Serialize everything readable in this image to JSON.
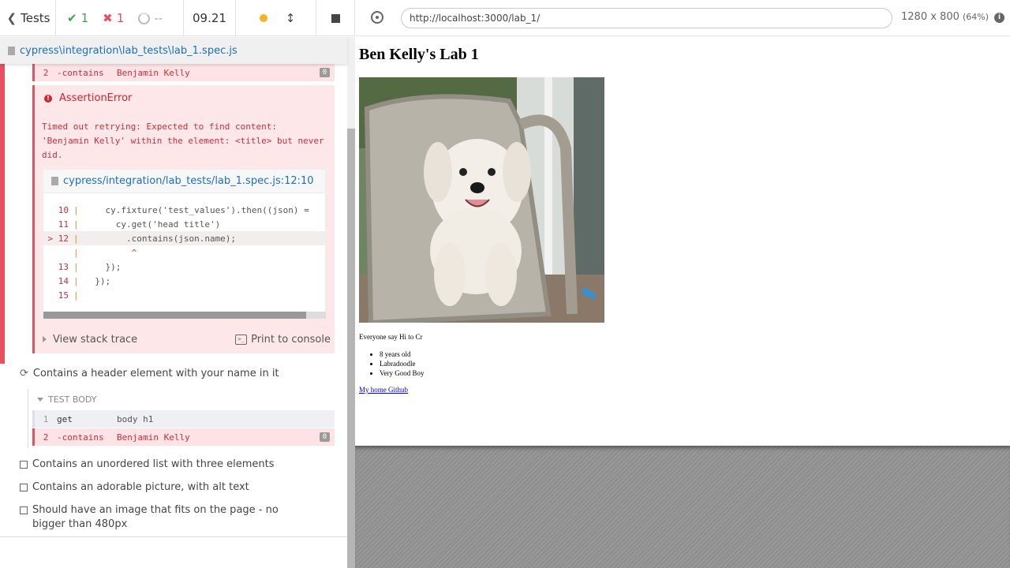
{
  "topbar": {
    "tests_label": "Tests",
    "passed": "1",
    "failed": "1",
    "pending": "--",
    "duration": "09.21"
  },
  "spec": {
    "path": "cypress\\integration\\lab_tests\\lab_1.spec.js"
  },
  "test1": {
    "cmd_num": "2",
    "cmd_name": "-contains",
    "cmd_arg": "Benjamin Kelly",
    "badge": "0",
    "error": {
      "title": "AssertionError",
      "message_line1": "Timed out retrying: Expected to find content:",
      "message_line2": "'Benjamin Kelly' within the element: <title> but never",
      "message_line3": "did.",
      "file_link": "cypress/integration/lab_tests/lab_1.spec.js:12:10",
      "code": [
        {
          "ln": "10",
          "text": "    cy.fixture('test_values').then((json) ="
        },
        {
          "ln": "11",
          "text": "      cy.get('head title')"
        },
        {
          "ln": "> 12",
          "text": "        .contains(json.name);"
        },
        {
          "ln": "",
          "text": "         ^"
        },
        {
          "ln": "13",
          "text": "    });"
        },
        {
          "ln": "14",
          "text": "  });"
        },
        {
          "ln": "15",
          "text": ""
        }
      ],
      "view_stack": "View stack trace",
      "print_console": "Print to console"
    }
  },
  "test2": {
    "title": "Contains a header element with your name in it",
    "section": "TEST BODY",
    "cmds": [
      {
        "num": "1",
        "name": "get",
        "arg": "body h1"
      },
      {
        "num": "2",
        "name": "-contains",
        "arg": "Benjamin Kelly",
        "badge": "0"
      }
    ]
  },
  "pending_tests": [
    "Contains an unordered list with three elements",
    "Contains an adorable picture, with alt text",
    "Should have an image that fits on the page - no bigger than 480px"
  ],
  "browser": {
    "url": "http://localhost:3000/lab_1/",
    "viewport": "1280 x 800",
    "scale": "(64%)"
  },
  "aut": {
    "heading": "Ben Kelly's Lab 1",
    "caption": "Everyone say Hi to Cr",
    "list": [
      "8 years old",
      "Labradoodle",
      "Very Good Boy"
    ],
    "link": "My home Github"
  },
  "colors": {
    "pass": "#3fa34d",
    "fail": "#e94f5f",
    "link": "#1a6fc9",
    "running": "#f3b324"
  }
}
